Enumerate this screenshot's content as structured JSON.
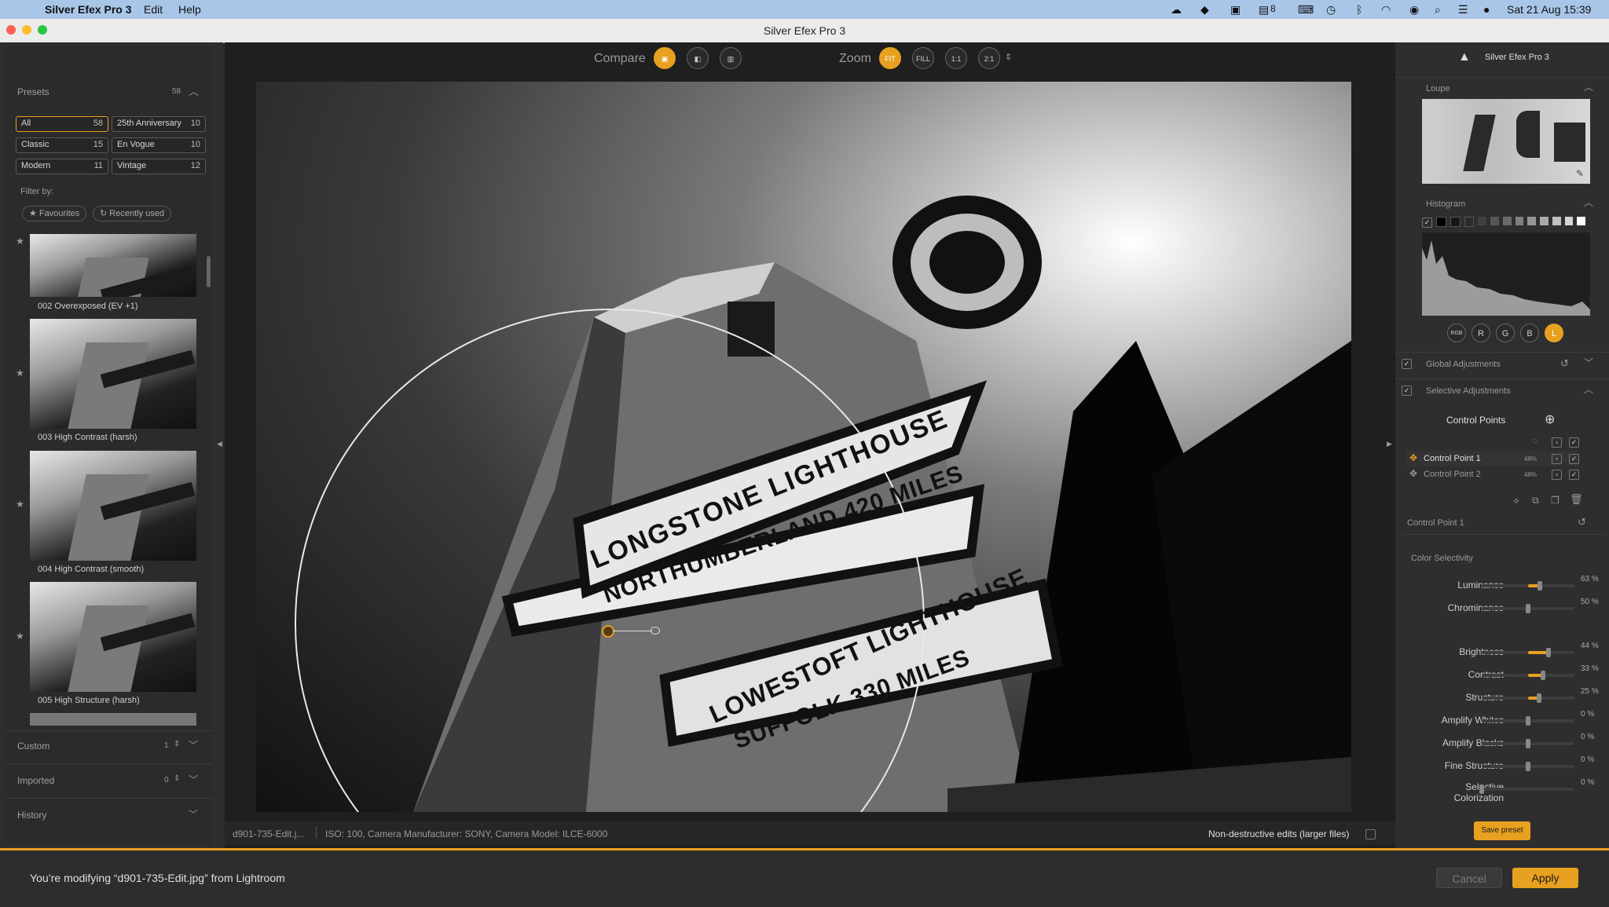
{
  "menubar": {
    "app": "Silver Efex Pro 3",
    "edit": "Edit",
    "help": "Help",
    "clock": "Sat 21 Aug  15:39",
    "badge": "8"
  },
  "window": {
    "title": "Silver Efex Pro 3"
  },
  "presets": {
    "header": "Presets",
    "count": "58",
    "filters": [
      {
        "label": "All",
        "count": "58"
      },
      {
        "label": "25th Anniversary",
        "count": "10"
      },
      {
        "label": "Classic",
        "count": "15"
      },
      {
        "label": "En Vogue",
        "count": "10"
      },
      {
        "label": "Modern",
        "count": "11"
      },
      {
        "label": "Vintage",
        "count": "12"
      }
    ],
    "filter_by": "Filter by:",
    "favourites": "★ Favourites",
    "recently": "↻ Recently used",
    "items": [
      "002 Overexposed (EV +1)",
      "003 High Contrast (harsh)",
      "004 High Contrast (smooth)",
      "005 High Structure (harsh)"
    ]
  },
  "sections": {
    "custom": "Custom",
    "custom_count": "1",
    "imported": "Imported",
    "imported_count": "0",
    "history": "History"
  },
  "toolbar": {
    "compare": "Compare",
    "zoom": "Zoom",
    "fit": "FIT",
    "fill": "FILL",
    "one": "1:1",
    "two": "2:1"
  },
  "photo": {
    "sign1a": "LONGSTONE LIGHTHOUSE",
    "sign1b": "NORTHUMBERLAND 420 MILES",
    "sign2a": "LOWESTOFT LIGHTHOUSE",
    "sign2b": "SUFFOLK   330 MILES"
  },
  "status": {
    "file": "d901-735-Edit.j...",
    "meta": "ISO: 100, Camera Manufacturer: SONY, Camera Model: ILCE-6000",
    "nondestructive": "Non-destructive edits (larger files)"
  },
  "right": {
    "brand": "Silver Efex Pro 3",
    "loupe": "Loupe",
    "histogram": "Histogram",
    "channels": [
      "RGB",
      "R",
      "G",
      "B",
      "L"
    ],
    "global": "Global Adjustments",
    "selective": "Selective Adjustments",
    "control_points": "Control Points",
    "cp1": "Control Point 1",
    "cp2": "Control Point 2",
    "cp1_pct": "48%",
    "cp2_pct": "48%",
    "cp_selected": "Control Point 1",
    "color_selectivity": "Color Selectivity",
    "sliders": [
      {
        "label": "Luminance",
        "value": "63 %",
        "frac": 0.63
      },
      {
        "label": "Chrominance",
        "value": "50 %",
        "frac": 0.5
      },
      {
        "label": "Brightness",
        "value": "44 %",
        "frac": 0.72
      },
      {
        "label": "Contrast",
        "value": "33 %",
        "frac": 0.66
      },
      {
        "label": "Structure",
        "value": "25 %",
        "frac": 0.62
      },
      {
        "label": "Amplify Whites",
        "value": "0 %",
        "frac": 0.5
      },
      {
        "label": "Amplify Blacks",
        "value": "0 %",
        "frac": 0.5
      },
      {
        "label": "Fine Structure",
        "value": "0 %",
        "frac": 0.5
      },
      {
        "label": "Selective Colorization",
        "value": "0 %",
        "frac": 0.0
      }
    ],
    "save_preset": "Save preset"
  },
  "bottom": {
    "message": "You’re modifying “d901-735-Edit.jpg” from Lightroom",
    "cancel": "Cancel",
    "apply": "Apply"
  },
  "colors": {
    "accent": "#e8a020"
  }
}
